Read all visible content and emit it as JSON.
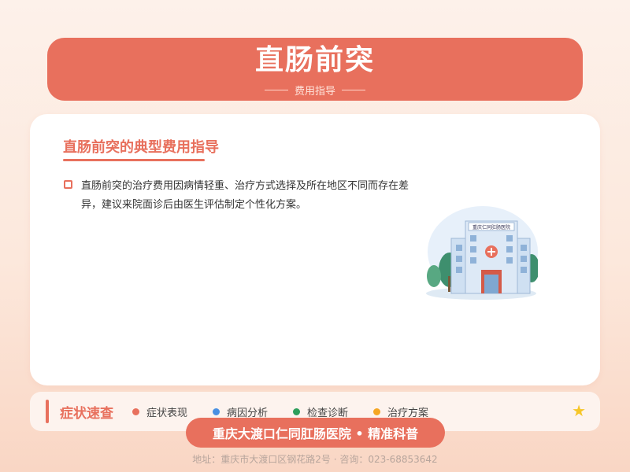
{
  "header": {
    "title": "直肠前突",
    "subtitle": "费用指导"
  },
  "card": {
    "heading": "直肠前突的典型费用指导",
    "paragraph": "直肠前突的治疗费用因病情轻重、治疗方式选择及所在地区不同而存在差异，建议来院面诊后由医生评估制定个性化方案。",
    "illustration": {
      "sign": "重庆仁同肛肠医院",
      "icon": "hospital-building-icon"
    }
  },
  "bottom_bar": {
    "label": "症状速查",
    "tags": [
      {
        "label": "症状表现",
        "color": "#e8705d"
      },
      {
        "label": "病因分析",
        "color": "#4a90e2"
      },
      {
        "label": "检查诊断",
        "color": "#2e9e5b"
      },
      {
        "label": "治疗方案",
        "color": "#f5a623"
      }
    ],
    "star_icon": "star-icon"
  },
  "banner": {
    "text": "重庆大渡口仁同肛肠医院 • 精准科普"
  },
  "footer": {
    "text": "地址：重庆市大渡口区钢花路2号 · 咨询：023-68853642"
  },
  "colors": {
    "accent": "#e8705d",
    "background": "#fdf1ea",
    "star": "#f6c628"
  }
}
